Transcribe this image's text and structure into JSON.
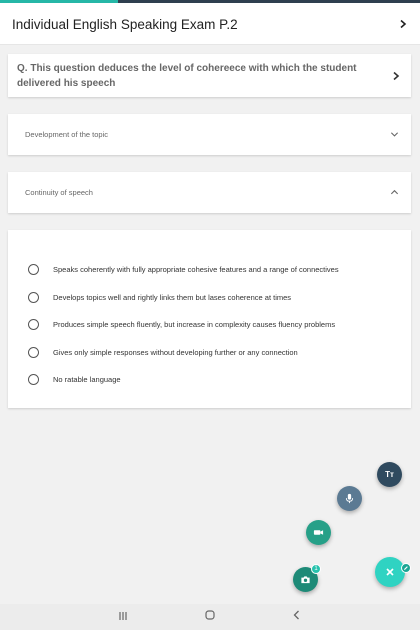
{
  "progress": {
    "fraction": 0.28,
    "track_color": "#2f3f4f",
    "fill_color": "#26b7a7"
  },
  "header": {
    "title": "Individual English Speaking Exam P.2",
    "icon": "chevron-right-icon"
  },
  "question": {
    "text": "Q. This question deduces the level of cohereece with which the student delivered his speech",
    "icon": "chevron-right-icon"
  },
  "accordions": [
    {
      "label": "Development of the topic",
      "state": "collapsed",
      "icon": "chevron-down-icon"
    },
    {
      "label": "Continuity of speech",
      "state": "expanded",
      "icon": "chevron-up-icon"
    }
  ],
  "options": [
    "Speaks coherently with fully appropriate cohesive features and a range of connectives",
    "Develops topics well and rightly links them but lases coherence at times",
    "Produces simple speech fluently, but increase in complexity causes fluency problems",
    "Gives only simple responses without developing further or any connection",
    "No ratable language"
  ],
  "fabs": {
    "text_label": "Tт",
    "camera_badge": "1",
    "icons": [
      "text-format-icon",
      "microphone-icon",
      "video-camera-icon",
      "camera-icon",
      "close-icon",
      "edit-icon"
    ]
  },
  "navbar": {
    "icons": [
      "recent-apps-icon",
      "home-icon",
      "back-icon"
    ]
  }
}
